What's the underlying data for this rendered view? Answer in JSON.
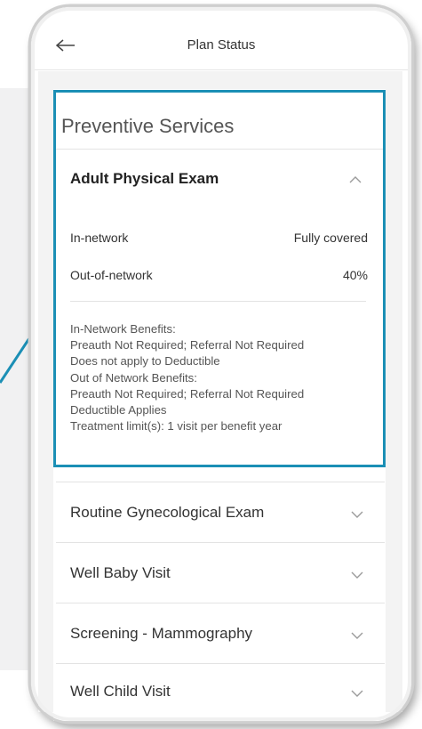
{
  "header": {
    "title": "Plan Status"
  },
  "section": {
    "title": "Preventive Services"
  },
  "expanded": {
    "title": "Adult Physical Exam",
    "rows": [
      {
        "label": "In-network",
        "value": "Fully covered"
      },
      {
        "label": "Out-of-network",
        "value": "40%"
      }
    ],
    "details": [
      "In-Network Benefits:",
      "Preauth Not Required; Referral Not Required",
      "Does not apply to Deductible",
      "Out of Network Benefits:",
      "Preauth Not Required; Referral Not Required",
      "Deductible Applies",
      "Treatment limit(s): 1 visit per benefit year"
    ]
  },
  "items": [
    {
      "label": "Routine Gynecological Exam"
    },
    {
      "label": "Well Baby Visit"
    },
    {
      "label": "Screening - Mammography"
    },
    {
      "label": "Well Child Visit"
    }
  ],
  "colors": {
    "highlight": "#1b8fb5",
    "chevron": "#9a9a9a"
  },
  "icons": {
    "back": "arrow-left-icon",
    "collapse": "chevron-up-icon",
    "expand": "chevron-down-icon"
  }
}
